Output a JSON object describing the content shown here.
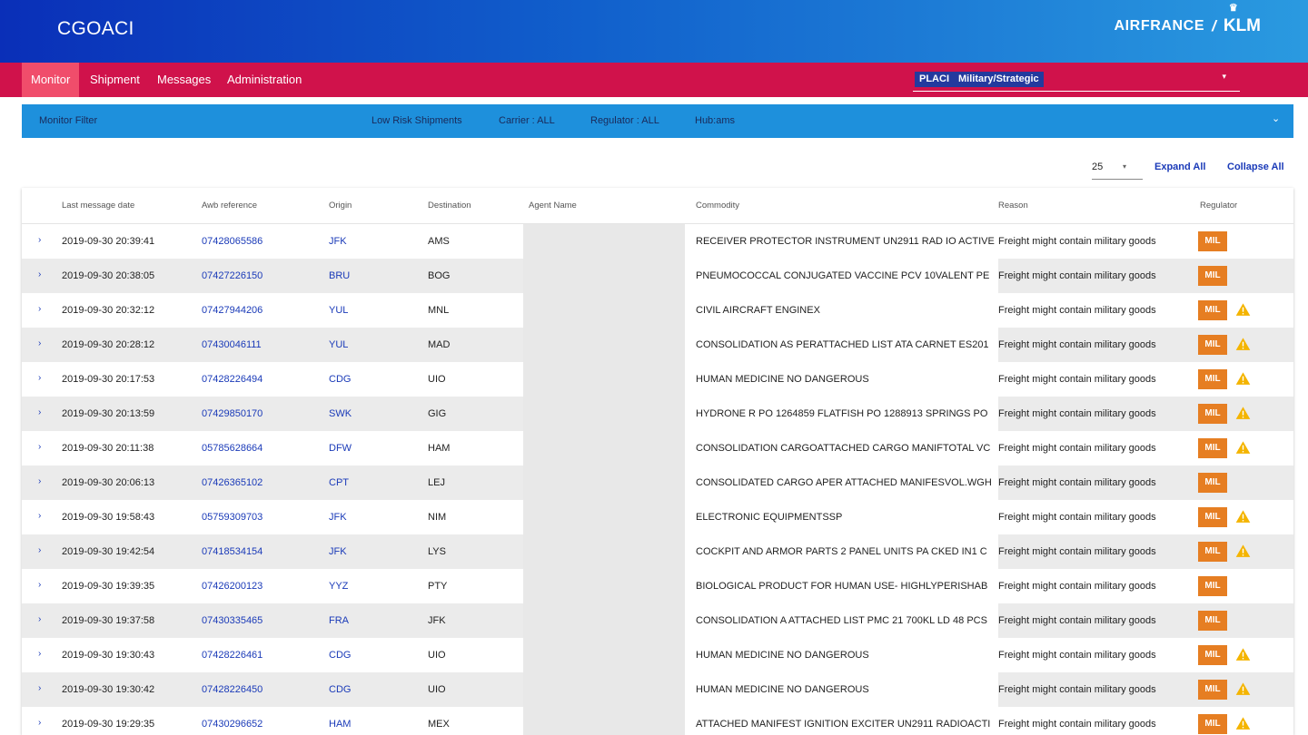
{
  "app": {
    "title": "CGOACI"
  },
  "brand": {
    "name_left": "AIRFRANCE",
    "slash": "/",
    "name_right": "KLM",
    "crown_icon": "crown-icon"
  },
  "nav": {
    "items": [
      {
        "label": "Monitor",
        "active": true
      },
      {
        "label": "Shipment",
        "active": false
      },
      {
        "label": "Messages",
        "active": false
      },
      {
        "label": "Administration",
        "active": false
      }
    ]
  },
  "filter_select": {
    "chips": [
      "PLACI",
      "Military/Strategic"
    ],
    "caret": "▾"
  },
  "filter_bar": {
    "title": "Monitor Filter",
    "low_risk": "Low Risk Shipments",
    "carrier": "Carrier : ALL",
    "regulator": "Regulator : ALL",
    "hub": "Hub:ams",
    "chevron": "⌄"
  },
  "paging": {
    "page_size": "25",
    "expand_all": "Expand All",
    "collapse_all": "Collapse All"
  },
  "table": {
    "columns": [
      "Last message date",
      "Awb reference",
      "Origin",
      "Destination",
      "Agent Name",
      "Commodity",
      "Reason",
      "Regulator"
    ],
    "expander_glyph": "›",
    "rows": [
      {
        "date": "2019-09-30 20:39:41",
        "awb": "07428065586",
        "origin": "JFK",
        "destination": "AMS",
        "agent": "",
        "commodity": "RECEIVER PROTECTOR INSTRUMENT UN2911 RAD IO ACTIVE",
        "reason": "Freight might contain military goods",
        "regulator": "MIL",
        "warning": false
      },
      {
        "date": "2019-09-30 20:38:05",
        "awb": "07427226150",
        "origin": "BRU",
        "destination": "BOG",
        "agent": "",
        "commodity": "PNEUMOCOCCAL CONJUGATED VACCINE PCV 10VALENT PE",
        "reason": "Freight might contain military goods",
        "regulator": "MIL",
        "warning": false
      },
      {
        "date": "2019-09-30 20:32:12",
        "awb": "07427944206",
        "origin": "YUL",
        "destination": "MNL",
        "agent": "",
        "commodity": "CIVIL AIRCRAFT ENGINEX",
        "reason": "Freight might contain military goods",
        "regulator": "MIL",
        "warning": true
      },
      {
        "date": "2019-09-30 20:28:12",
        "awb": "07430046111",
        "origin": "YUL",
        "destination": "MAD",
        "agent": "",
        "commodity": "CONSOLIDATION AS PERATTACHED LIST ATA CARNET ES201",
        "reason": "Freight might contain military goods",
        "regulator": "MIL",
        "warning": true
      },
      {
        "date": "2019-09-30 20:17:53",
        "awb": "07428226494",
        "origin": "CDG",
        "destination": "UIO",
        "agent": "",
        "commodity": "HUMAN MEDICINE NO DANGEROUS",
        "reason": "Freight might contain military goods",
        "regulator": "MIL",
        "warning": true
      },
      {
        "date": "2019-09-30 20:13:59",
        "awb": "07429850170",
        "origin": "SWK",
        "destination": "GIG",
        "agent": "",
        "commodity": "HYDRONE R PO 1264859 FLATFISH PO 1288913 SPRINGS PO",
        "reason": "Freight might contain military goods",
        "regulator": "MIL",
        "warning": true
      },
      {
        "date": "2019-09-30 20:11:38",
        "awb": "05785628664",
        "origin": "DFW",
        "destination": "HAM",
        "agent": "",
        "commodity": "CONSOLIDATION CARGOATTACHED CARGO MANIFTOTAL VC",
        "reason": "Freight might contain military goods",
        "regulator": "MIL",
        "warning": true
      },
      {
        "date": "2019-09-30 20:06:13",
        "awb": "07426365102",
        "origin": "CPT",
        "destination": "LEJ",
        "agent": "",
        "commodity": "CONSOLIDATED CARGO APER ATTACHED MANIFESVOL.WGH",
        "reason": "Freight might contain military goods",
        "regulator": "MIL",
        "warning": false
      },
      {
        "date": "2019-09-30 19:58:43",
        "awb": "05759309703",
        "origin": "JFK",
        "destination": "NIM",
        "agent": "",
        "commodity": "ELECTRONIC EQUIPMENTSSP",
        "reason": "Freight might contain military goods",
        "regulator": "MIL",
        "warning": true
      },
      {
        "date": "2019-09-30 19:42:54",
        "awb": "07418534154",
        "origin": "JFK",
        "destination": "LYS",
        "agent": "",
        "commodity": "COCKPIT AND ARMOR PARTS 2 PANEL UNITS PA CKED IN1 C",
        "reason": "Freight might contain military goods",
        "regulator": "MIL",
        "warning": true
      },
      {
        "date": "2019-09-30 19:39:35",
        "awb": "07426200123",
        "origin": "YYZ",
        "destination": "PTY",
        "agent": "",
        "commodity": "BIOLOGICAL PRODUCT FOR HUMAN USE- HIGHLYPERISHAB",
        "reason": "Freight might contain military goods",
        "regulator": "MIL",
        "warning": false
      },
      {
        "date": "2019-09-30 19:37:58",
        "awb": "07430335465",
        "origin": "FRA",
        "destination": "JFK",
        "agent": "",
        "commodity": "CONSOLIDATION A ATTACHED LIST PMC 21 700KL LD 48 PCS",
        "reason": "Freight might contain military goods",
        "regulator": "MIL",
        "warning": false
      },
      {
        "date": "2019-09-30 19:30:43",
        "awb": "07428226461",
        "origin": "CDG",
        "destination": "UIO",
        "agent": "",
        "commodity": "HUMAN MEDICINE NO DANGEROUS",
        "reason": "Freight might contain military goods",
        "regulator": "MIL",
        "warning": true
      },
      {
        "date": "2019-09-30 19:30:42",
        "awb": "07428226450",
        "origin": "CDG",
        "destination": "UIO",
        "agent": "",
        "commodity": "HUMAN MEDICINE NO DANGEROUS",
        "reason": "Freight might contain military goods",
        "regulator": "MIL",
        "warning": true
      },
      {
        "date": "2019-09-30 19:29:35",
        "awb": "07430296652",
        "origin": "HAM",
        "destination": "MEX",
        "agent": "",
        "commodity": "ATTACHED MANIFEST IGNITION EXCITER UN2911 RADIOACTI",
        "reason": "Freight might contain military goods",
        "regulator": "MIL",
        "warning": true
      }
    ]
  },
  "colors": {
    "header_gradient": [
      "#0a2fb8",
      "#2a9ae0"
    ],
    "nav_bg": "#d0124b",
    "nav_active": "#f04d6b",
    "filter_bar": "#1e90dc",
    "link": "#1a3ab8",
    "mil_badge": "#e67e22",
    "warning": "#f4b400"
  }
}
